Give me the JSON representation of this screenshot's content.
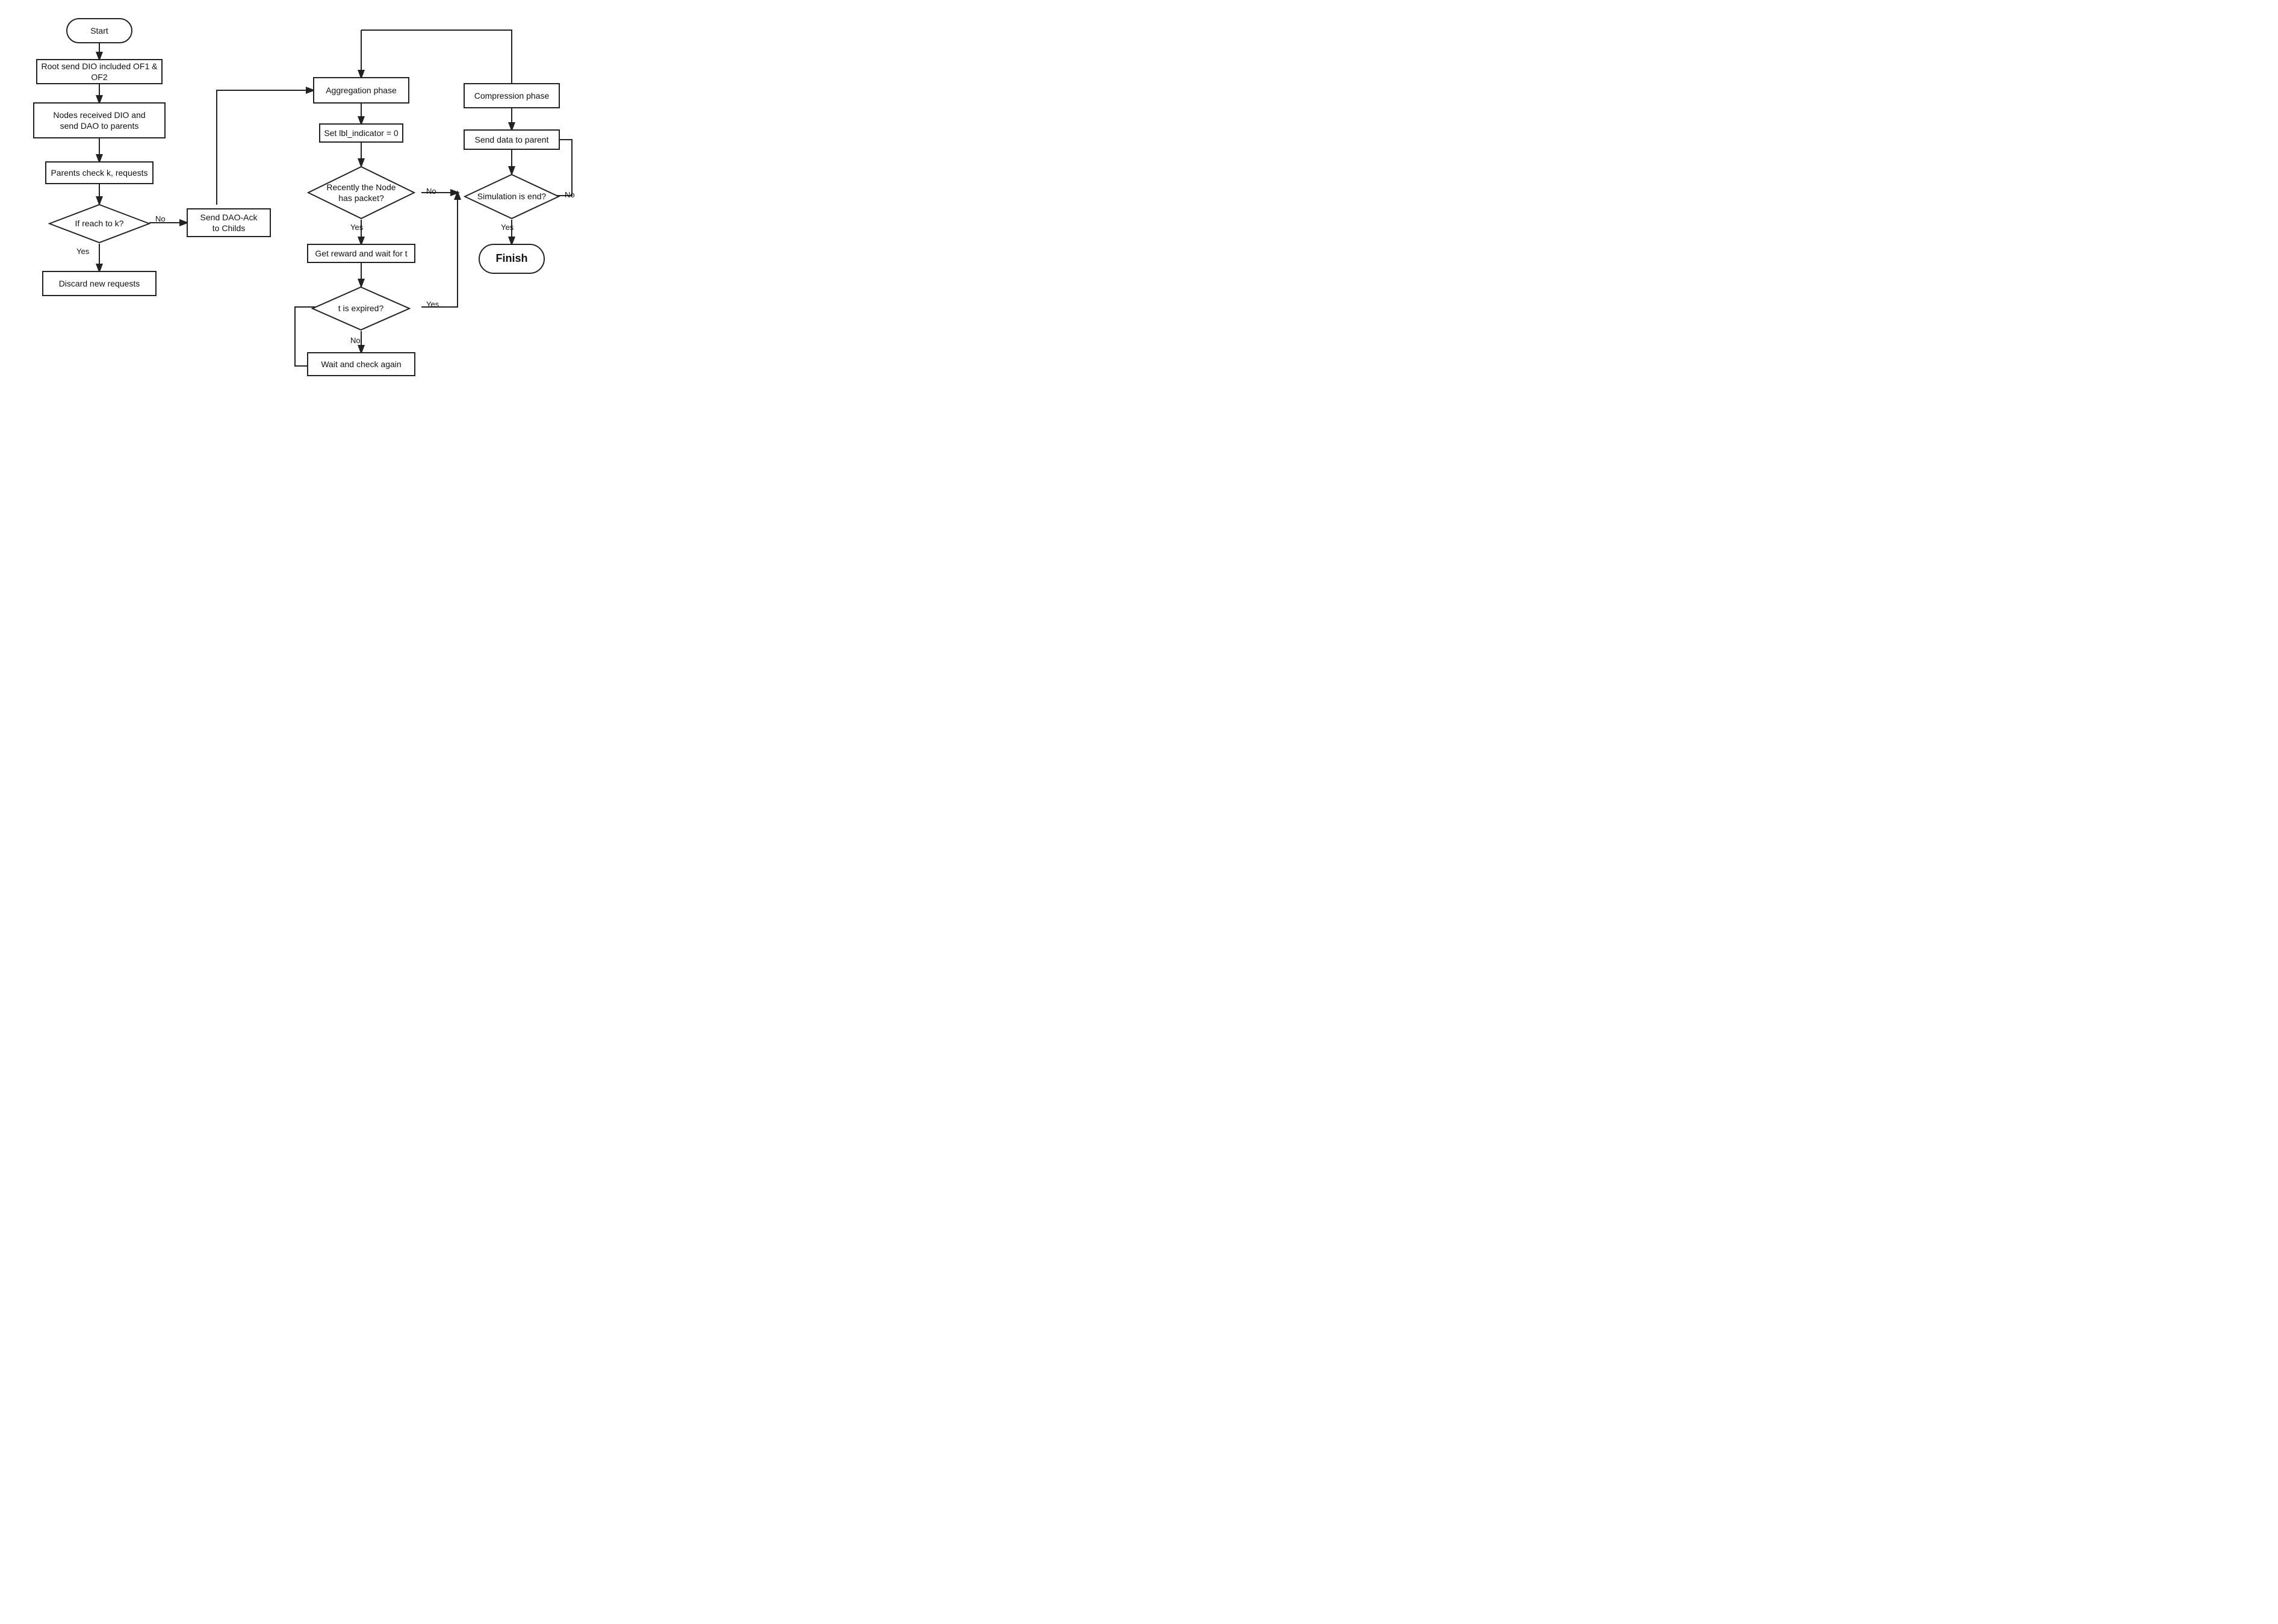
{
  "nodes": {
    "start": {
      "label": "Start"
    },
    "root_send": {
      "label": "Root send DIO included OF1 & OF2"
    },
    "nodes_received": {
      "label": "Nodes received DIO and\nsend DAO to parents"
    },
    "parents_check": {
      "label": "Parents check k, requests"
    },
    "if_reach_k": {
      "label": "If reach to k?"
    },
    "send_dao_ack": {
      "label": "Send DAO-Ack\nto Childs"
    },
    "discard_new": {
      "label": "Discard new requests"
    },
    "aggregation_phase": {
      "label": "Aggregation phase"
    },
    "set_lbl": {
      "label": "Set lbl_indicator = 0"
    },
    "recently_node": {
      "label": "Recently the\nNode has packet?"
    },
    "get_reward": {
      "label": "Get reward and wait for t"
    },
    "t_expired": {
      "label": "t is expired?"
    },
    "wait_check": {
      "label": "Wait and check again"
    },
    "compression_phase": {
      "label": "Compression phase"
    },
    "send_data": {
      "label": "Send data to parent"
    },
    "simulation_end": {
      "label": "Simulation\nis end?"
    },
    "finish": {
      "label": "Finish"
    }
  },
  "labels": {
    "yes": "Yes",
    "no": "No"
  }
}
